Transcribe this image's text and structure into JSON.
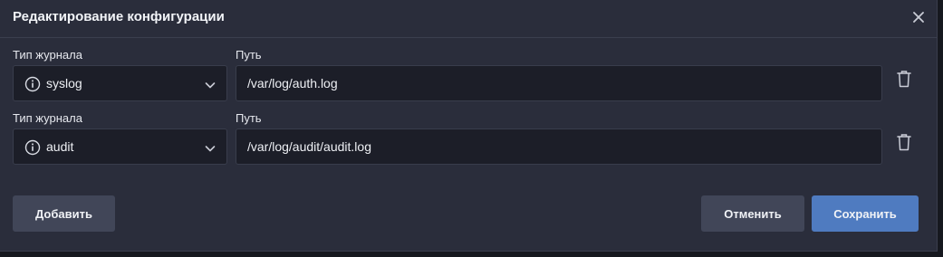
{
  "dialog": {
    "title": "Редактирование конфигурации",
    "close_icon": "close-icon"
  },
  "rows": [
    {
      "type_label": "Тип журнала",
      "type_value": "syslog",
      "path_label": "Путь",
      "path_value": "/var/log/auth.log"
    },
    {
      "type_label": "Тип журнала",
      "type_value": "audit",
      "path_label": "Путь",
      "path_value": "/var/log/audit/audit.log"
    }
  ],
  "buttons": {
    "add": "Добавить",
    "cancel": "Отменить",
    "save": "Сохранить"
  },
  "colors": {
    "dialog_bg": "#2a2d3b",
    "field_bg": "#1c1e28",
    "primary": "#4f7bc0",
    "secondary": "#414658"
  }
}
